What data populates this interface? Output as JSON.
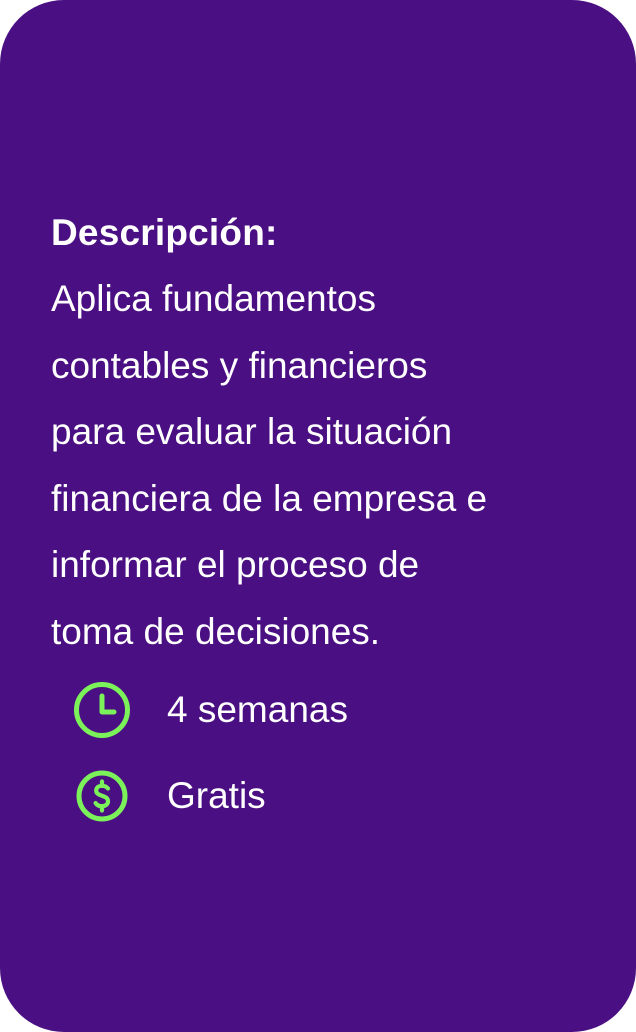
{
  "course": {
    "description_title": "Descripción:",
    "description_lines": "Aplica fundamentos\ncontables y financieros\npara evaluar la situación\nfinanciera de la empresa e\ninformar el proceso de\ntoma de decisiones.",
    "duration_icon": "clock-icon",
    "duration": "4 semanas",
    "price_icon": "dollar-circle-icon",
    "price": "Gratis"
  },
  "colors": {
    "card_background": "#4a0f82",
    "text": "#ffffff",
    "icon_accent": "#7cf25a"
  }
}
